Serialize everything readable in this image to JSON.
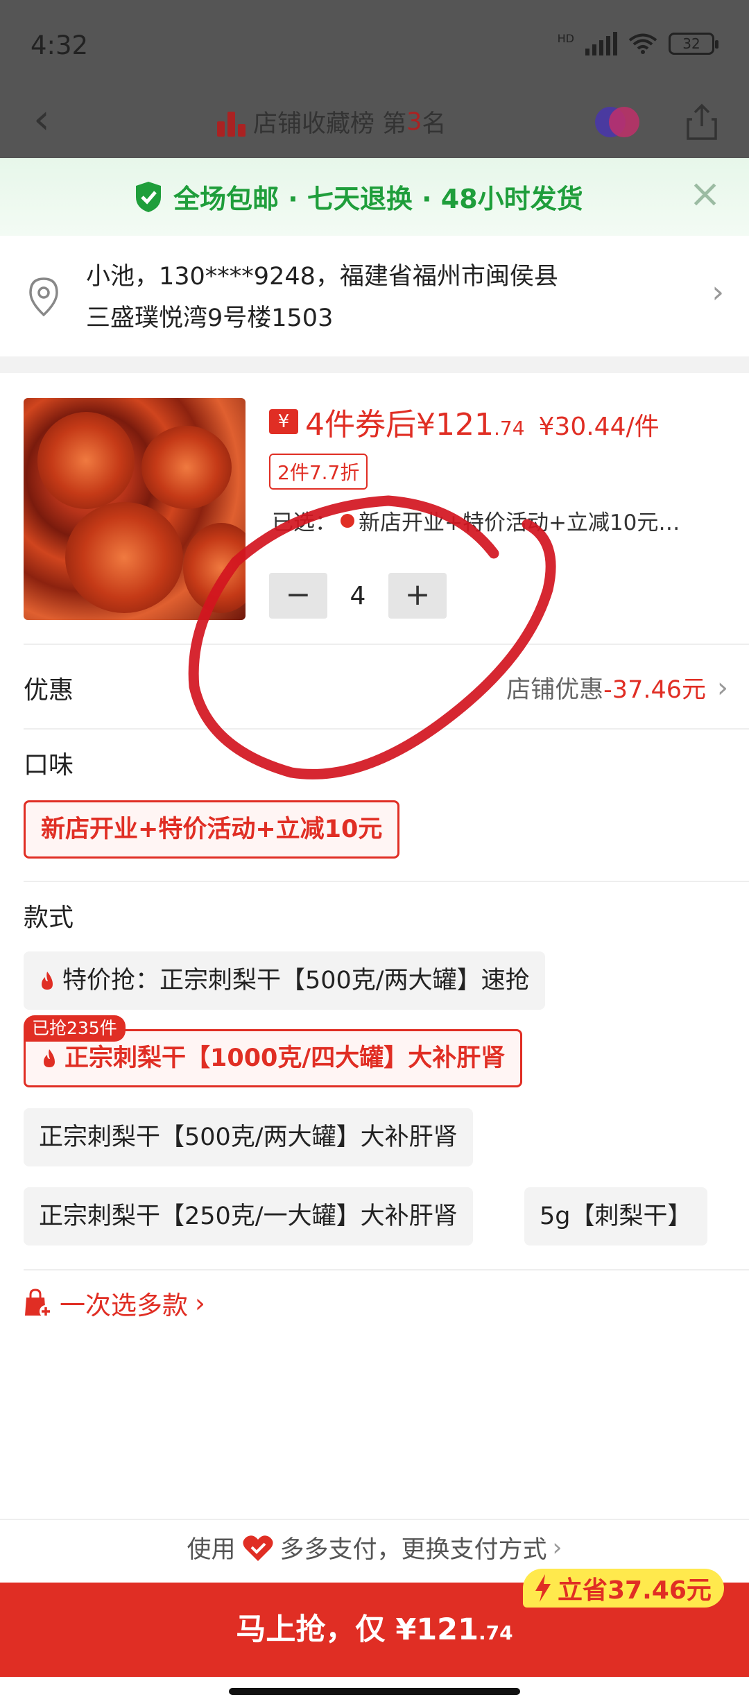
{
  "status_bar": {
    "time": "4:32",
    "network": "HD",
    "battery": "32"
  },
  "nav": {
    "rank_prefix": "店铺收藏榜 第",
    "rank_number": "3",
    "rank_suffix": "名"
  },
  "banner": {
    "text": "全场包邮 · 七天退换 · 48小时发货"
  },
  "address": {
    "line1": "小池，130****9248，福建省福州市闽侯县",
    "line2": "三盛璞悦湾9号楼1503"
  },
  "product": {
    "coupon_icon": "¥",
    "price_prefix": "4件券后¥121",
    "price_decimal": ".74",
    "unit_price": "¥30.44/件",
    "discount_tag": "2件7.7折",
    "selected_label": "已选：",
    "selected_value": "新店开业+特价活动+立减10元…",
    "quantity": "4",
    "minus": "−",
    "plus": "+"
  },
  "youhui": {
    "label": "优惠",
    "store_label": "店铺优惠",
    "amount": "-37.46元"
  },
  "flavor": {
    "label": "口味",
    "options": [
      "新店开业+特价活动+立减10元"
    ]
  },
  "style": {
    "label": "款式",
    "options": [
      "特价抢：正宗刺梨干【500克/两大罐】速抢",
      "正宗刺梨干【1000克/四大罐】大补肝肾",
      "正宗刺梨干【500克/两大罐】大补肝肾",
      "正宗刺梨干【250克/一大罐】大补肝肾",
      "5g【刺梨干】"
    ],
    "sold_badge": "已抢235件"
  },
  "multi_select": "一次选多款",
  "payment": {
    "use": "使用",
    "method": "多多支付，更换支付方式"
  },
  "cta": {
    "label": "马上抢，仅 ¥121",
    "decimal": ".74",
    "save": "立省37.46元"
  },
  "colors": {
    "accent": "#e02e24",
    "green": "#1f9e3b",
    "save_badge": "#ffe94d"
  }
}
